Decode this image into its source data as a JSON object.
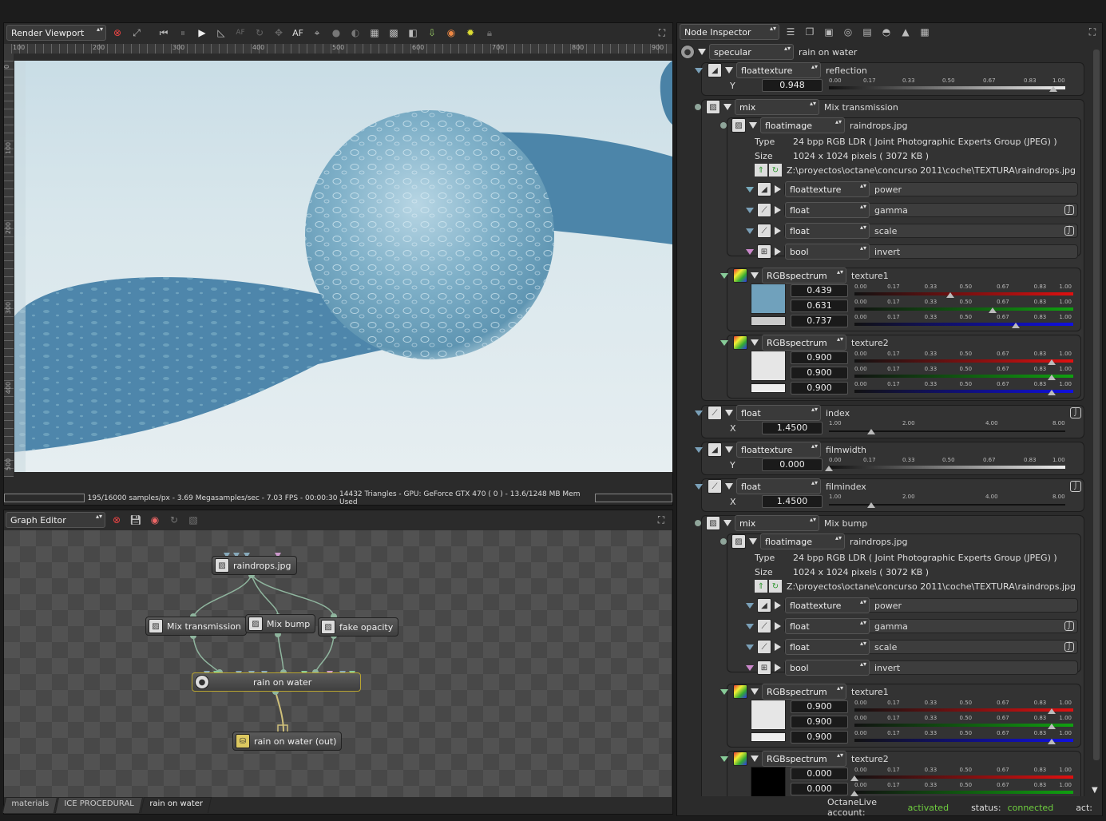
{
  "render_viewport": {
    "mode": "Render Viewport",
    "toolbar_icons": [
      "stop-icon",
      "reset-camera-icon",
      "rewind-icon",
      "pause-icon",
      "play-icon",
      "measure-icon",
      "autofocus-off-icon",
      "lock-rotate-icon",
      "lock-pan-icon",
      "autofocus-label",
      "pick-focus-icon",
      "sphere-icon",
      "sphere-dark-icon",
      "grid-icon",
      "checker-icon",
      "half-icon",
      "export-icon",
      "picker-icon",
      "sun-icon",
      "lock-icon",
      "fullscreen-icon"
    ],
    "af_label": "AF",
    "ruler_h": [
      "100",
      "200",
      "300",
      "400",
      "500",
      "600",
      "700",
      "800",
      "900"
    ],
    "ruler_v": [
      "0",
      "100",
      "200",
      "300",
      "400",
      "500"
    ],
    "status_left": "195/16000 samples/px - 3.69 Megasamples/sec - 7.03 FPS - 00:00:30",
    "status_right": "14432 Triangles - GPU: GeForce GTX 470 ( 0 ) - 13.6/1248 MB Mem Used"
  },
  "graph_editor": {
    "mode": "Graph Editor",
    "nodes": {
      "raindrops": "raindrops.jpg",
      "mix_transmission": "Mix transmission",
      "mix_bump": "Mix bump",
      "fake_opacity": "fake opacity",
      "rain_on_water": "rain on water",
      "rain_on_water_out": "rain on water (out)"
    },
    "tabs": [
      "materials",
      "ICE PROCEDURAL",
      "rain on water"
    ]
  },
  "inspector": {
    "mode": "Node Inspector",
    "root": {
      "type": "specular",
      "name": "rain on water"
    },
    "reflection": {
      "type": "floattexture",
      "name": "reflection",
      "axis": "Y",
      "value": "0.948",
      "ticks": [
        "0.00",
        "0.17",
        "0.33",
        "0.50",
        "0.67",
        "0.83",
        "1.00"
      ],
      "level": 0.948
    },
    "mix_transmission": {
      "type": "mix",
      "name": "Mix transmission",
      "image": {
        "type": "floatimage",
        "name": "raindrops.jpg",
        "type_label": "Type",
        "type_value": "24 bpp RGB LDR ( Joint Photographic Experts Group (JPEG) )",
        "size_label": "Size",
        "size_value": "1024 x 1024 pixels ( 3072 KB )",
        "path": "Z:\\proyectos\\octane\\concurso 2011\\coche\\TEXTURA\\raindrops.jpg"
      },
      "params": [
        {
          "type": "floattexture",
          "name": "power"
        },
        {
          "type": "float",
          "name": "gamma"
        },
        {
          "type": "float",
          "name": "scale"
        },
        {
          "type": "bool",
          "name": "invert"
        }
      ],
      "texture1": {
        "type": "RGBspectrum",
        "name": "texture1",
        "r": "0.439",
        "g": "0.631",
        "b": "0.737",
        "rv": 0.439,
        "gv": 0.631,
        "bv": 0.737,
        "swatch": "#70a1bc"
      },
      "texture2": {
        "type": "RGBspectrum",
        "name": "texture2",
        "r": "0.900",
        "g": "0.900",
        "b": "0.900",
        "rv": 0.9,
        "gv": 0.9,
        "bv": 0.9,
        "swatch": "#e6e6e6"
      }
    },
    "index": {
      "type": "float",
      "name": "index",
      "axis": "X",
      "value": "1.4500",
      "ticks": [
        "1.00",
        "2.00",
        "4.00",
        "8.00"
      ],
      "level": 0.18
    },
    "filmwidth": {
      "type": "floattexture",
      "name": "filmwidth",
      "axis": "Y",
      "value": "0.000",
      "level": 0.0
    },
    "filmindex": {
      "type": "float",
      "name": "filmindex",
      "axis": "X",
      "value": "1.4500",
      "level": 0.18
    },
    "mix_bump": {
      "type": "mix",
      "name": "Mix bump",
      "image": {
        "type": "floatimage",
        "name": "raindrops.jpg"
      },
      "params": [
        {
          "type": "floattexture",
          "name": "power"
        },
        {
          "type": "float",
          "name": "gamma"
        },
        {
          "type": "float",
          "name": "scale"
        },
        {
          "type": "bool",
          "name": "invert"
        }
      ],
      "texture1": {
        "type": "RGBspectrum",
        "name": "texture1",
        "r": "0.900",
        "g": "0.900",
        "b": "0.900",
        "rv": 0.9,
        "gv": 0.9,
        "bv": 0.9,
        "swatch": "#e6e6e6"
      },
      "texture2": {
        "type": "RGBspectrum",
        "name": "texture2",
        "r": "0.000",
        "g": "0.000",
        "rv": 0.0,
        "gv": 0.0,
        "swatch": "#000000"
      }
    },
    "footer": {
      "account_label": "OctaneLive account:",
      "account_value": "activated",
      "status_label": "status:",
      "status_value": "connected",
      "act_label": "act:"
    }
  },
  "colors": {
    "accent_green": "#6fcf3f",
    "red_track": "#e01010",
    "green_track": "#10a010",
    "blue_track": "#1010e0"
  }
}
